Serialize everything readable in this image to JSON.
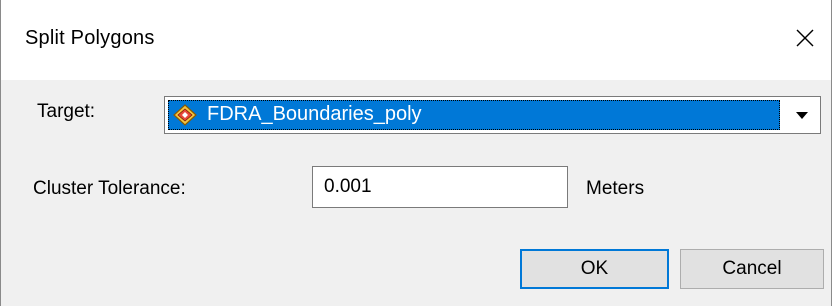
{
  "window": {
    "title": "Split Polygons",
    "close_icon": "close-icon"
  },
  "form": {
    "target_label": "Target:",
    "target_value": "FDRA_Boundaries_poly",
    "target_icon": "polygon-layer-icon",
    "cluster_label": "Cluster Tolerance:",
    "cluster_value": "0.001",
    "units_label": "Meters"
  },
  "buttons": {
    "ok": "OK",
    "cancel": "Cancel"
  },
  "colors": {
    "selection": "#0078d7",
    "dialog_bg": "#f0f0f0"
  }
}
